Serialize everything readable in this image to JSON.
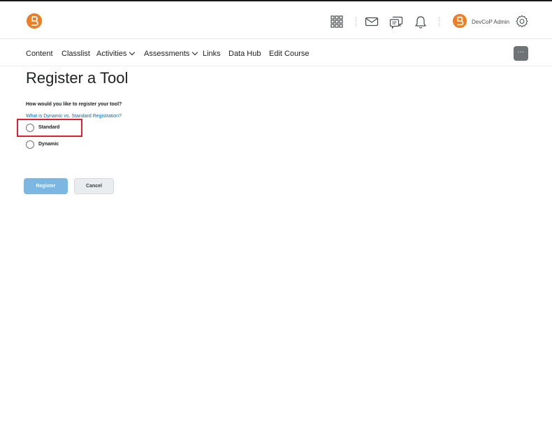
{
  "header": {
    "user_name": "DevCoP Admin",
    "brand_color": "#ef7d22",
    "icons": [
      "brand-logo-icon",
      "apps-grid-icon",
      "mail-icon",
      "chat-icon",
      "bell-icon",
      "avatar-logo-icon",
      "gear-icon"
    ]
  },
  "nav": {
    "items": [
      {
        "label": "Content"
      },
      {
        "label": "Classlist"
      },
      {
        "label": "Activities"
      },
      {
        "label": "Assessments"
      },
      {
        "label": "Links"
      },
      {
        "label": "Data Hub"
      },
      {
        "label": "Edit Course"
      }
    ],
    "more_label": "···"
  },
  "main": {
    "title": "Register a Tool",
    "question": "How would you like to register your tool?",
    "help_link": "What is Dynamic vs. Standard Registration?",
    "options": [
      {
        "label": "Standard",
        "selected": false
      },
      {
        "label": "Dynamic",
        "selected": false
      }
    ],
    "register_label": "Register",
    "cancel_label": "Cancel",
    "highlight_color": "#e0202e"
  }
}
